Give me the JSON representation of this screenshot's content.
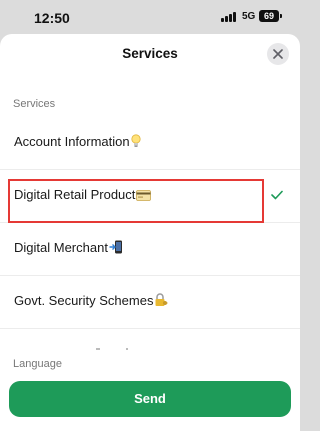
{
  "status_bar": {
    "time": "12:50",
    "network": "5G",
    "battery": "69"
  },
  "sheet": {
    "title": "Services",
    "close_icon": "close-icon",
    "section_services": "Services",
    "items": [
      {
        "label": "Account Information",
        "emoji": "lightbulb"
      },
      {
        "label": "Digital Retail Product",
        "emoji": "credit-card",
        "selected": true
      },
      {
        "label": "Digital Merchant",
        "emoji": "mobile-arrow"
      },
      {
        "label": "Govt. Security Schemes",
        "emoji": "lock-key"
      }
    ],
    "section_language": "Language",
    "send_label": "Send"
  },
  "colors": {
    "accent_green": "#1e9b59",
    "highlight_red": "#e53935",
    "check_green": "#1e9b59"
  }
}
